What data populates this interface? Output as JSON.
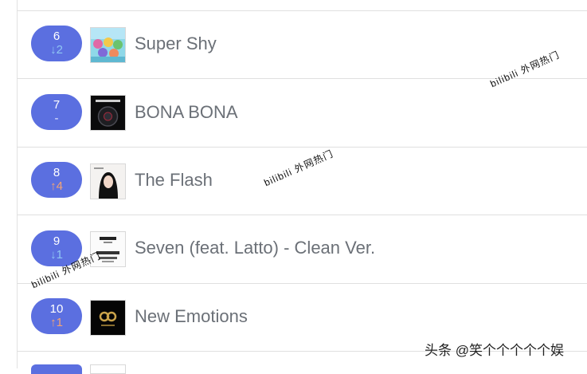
{
  "chart_rows": [
    {
      "rank": "6",
      "change": "↓2",
      "change_dir": "down",
      "title": "Super Shy",
      "cover_style": "colorful"
    },
    {
      "rank": "7",
      "change": "-",
      "change_dir": "same",
      "title": "BONA BONA",
      "cover_style": "dark-disc"
    },
    {
      "rank": "8",
      "change": "↑4",
      "change_dir": "up",
      "title": "The Flash",
      "cover_style": "portrait"
    },
    {
      "rank": "9",
      "change": "↓1",
      "change_dir": "down",
      "title": "Seven (feat. Latto) - Clean Ver.",
      "cover_style": "white-text"
    },
    {
      "rank": "10",
      "change": "↑1",
      "change_dir": "up",
      "title": "New Emotions",
      "cover_style": "black-gold"
    }
  ],
  "watermark_text": "bilibili 外网热门",
  "credit_text": "头条 @笑个个个个个娱",
  "colors": {
    "pill": "#5b6fe0",
    "down": "#8fc6f3",
    "up": "#f4a474",
    "title": "#6b7077"
  }
}
